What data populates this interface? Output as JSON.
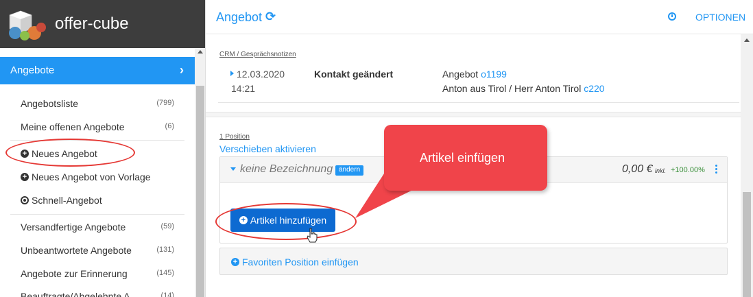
{
  "brand": {
    "name": "offer-cube"
  },
  "sidebar": {
    "section_label": "Angebote",
    "items": [
      {
        "label": "Angebotsliste",
        "count": "(799)"
      },
      {
        "label": "Meine offenen Angebote",
        "count": "(6)"
      }
    ],
    "create_items": [
      {
        "label": "Neues Angebot",
        "icon": "plus-circle-icon"
      },
      {
        "label": "Neues Angebot von Vorlage",
        "icon": "plus-circle-icon"
      },
      {
        "label": "Schnell-Angebot",
        "icon": "dot-circle-icon"
      }
    ],
    "status_items": [
      {
        "label": "Versandfertige Angebote",
        "count": "(59)"
      },
      {
        "label": "Unbeantwortete Angebote",
        "count": "(131)"
      },
      {
        "label": "Angebote zur Erinnerung",
        "count": "(145)"
      },
      {
        "label": "Beauftragte/Abgelehnte A",
        "count": "(14)"
      }
    ]
  },
  "header": {
    "title": "Angebot",
    "options_label": "OPTIONEN"
  },
  "crm": {
    "section_label": "CRM / Gesprächsnotizen",
    "date": "12.03.2020",
    "time": "14:21",
    "title": "Kontakt geändert",
    "line1_prefix": "Angebot ",
    "line1_link": "o1199",
    "line2_prefix": "Anton aus Tirol / Herr Anton Tirol ",
    "line2_link": "c220"
  },
  "positions": {
    "count_label": "1 Position",
    "move_label": "Verschieben aktivieren",
    "item": {
      "name": "keine Bezeichnung",
      "edit_label": "ändern",
      "price": "0,00 €",
      "price_suffix": "inkl.",
      "percent": "+100.00%"
    },
    "add_article_label": "Artikel hinzufügen",
    "favorites_label": "Favoriten Position einfügen"
  },
  "annotation": {
    "callout_text": "Artikel einfügen"
  },
  "colors": {
    "accent": "#2196f3",
    "brand_bar": "#3d3d3d",
    "button": "#0d6ad1",
    "callout": "#f0444a",
    "ring": "#e53935"
  }
}
